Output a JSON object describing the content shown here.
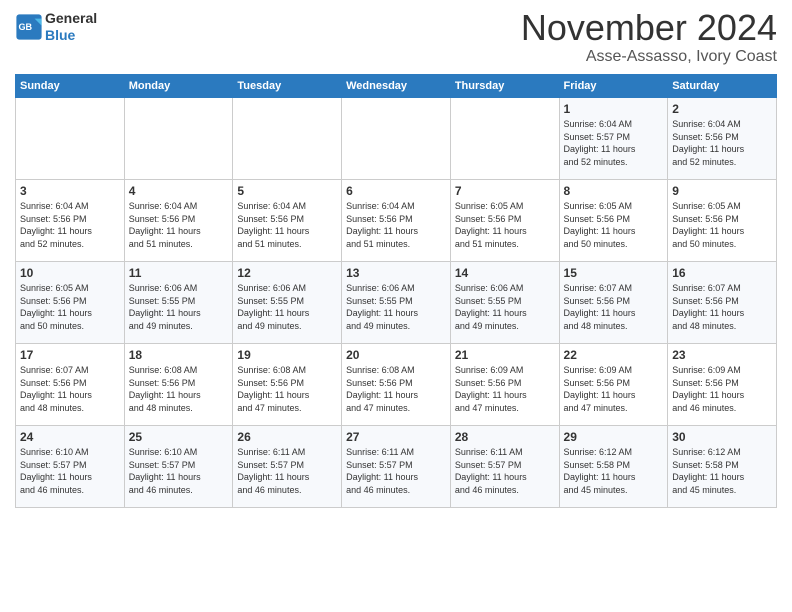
{
  "header": {
    "logo_line1": "General",
    "logo_line2": "Blue",
    "month_year": "November 2024",
    "location": "Asse-Assasso, Ivory Coast"
  },
  "days_of_week": [
    "Sunday",
    "Monday",
    "Tuesday",
    "Wednesday",
    "Thursday",
    "Friday",
    "Saturday"
  ],
  "weeks": [
    [
      {
        "day": "",
        "info": ""
      },
      {
        "day": "",
        "info": ""
      },
      {
        "day": "",
        "info": ""
      },
      {
        "day": "",
        "info": ""
      },
      {
        "day": "",
        "info": ""
      },
      {
        "day": "1",
        "info": "Sunrise: 6:04 AM\nSunset: 5:57 PM\nDaylight: 11 hours\nand 52 minutes."
      },
      {
        "day": "2",
        "info": "Sunrise: 6:04 AM\nSunset: 5:56 PM\nDaylight: 11 hours\nand 52 minutes."
      }
    ],
    [
      {
        "day": "3",
        "info": "Sunrise: 6:04 AM\nSunset: 5:56 PM\nDaylight: 11 hours\nand 52 minutes."
      },
      {
        "day": "4",
        "info": "Sunrise: 6:04 AM\nSunset: 5:56 PM\nDaylight: 11 hours\nand 51 minutes."
      },
      {
        "day": "5",
        "info": "Sunrise: 6:04 AM\nSunset: 5:56 PM\nDaylight: 11 hours\nand 51 minutes."
      },
      {
        "day": "6",
        "info": "Sunrise: 6:04 AM\nSunset: 5:56 PM\nDaylight: 11 hours\nand 51 minutes."
      },
      {
        "day": "7",
        "info": "Sunrise: 6:05 AM\nSunset: 5:56 PM\nDaylight: 11 hours\nand 51 minutes."
      },
      {
        "day": "8",
        "info": "Sunrise: 6:05 AM\nSunset: 5:56 PM\nDaylight: 11 hours\nand 50 minutes."
      },
      {
        "day": "9",
        "info": "Sunrise: 6:05 AM\nSunset: 5:56 PM\nDaylight: 11 hours\nand 50 minutes."
      }
    ],
    [
      {
        "day": "10",
        "info": "Sunrise: 6:05 AM\nSunset: 5:56 PM\nDaylight: 11 hours\nand 50 minutes."
      },
      {
        "day": "11",
        "info": "Sunrise: 6:06 AM\nSunset: 5:55 PM\nDaylight: 11 hours\nand 49 minutes."
      },
      {
        "day": "12",
        "info": "Sunrise: 6:06 AM\nSunset: 5:55 PM\nDaylight: 11 hours\nand 49 minutes."
      },
      {
        "day": "13",
        "info": "Sunrise: 6:06 AM\nSunset: 5:55 PM\nDaylight: 11 hours\nand 49 minutes."
      },
      {
        "day": "14",
        "info": "Sunrise: 6:06 AM\nSunset: 5:55 PM\nDaylight: 11 hours\nand 49 minutes."
      },
      {
        "day": "15",
        "info": "Sunrise: 6:07 AM\nSunset: 5:56 PM\nDaylight: 11 hours\nand 48 minutes."
      },
      {
        "day": "16",
        "info": "Sunrise: 6:07 AM\nSunset: 5:56 PM\nDaylight: 11 hours\nand 48 minutes."
      }
    ],
    [
      {
        "day": "17",
        "info": "Sunrise: 6:07 AM\nSunset: 5:56 PM\nDaylight: 11 hours\nand 48 minutes."
      },
      {
        "day": "18",
        "info": "Sunrise: 6:08 AM\nSunset: 5:56 PM\nDaylight: 11 hours\nand 48 minutes."
      },
      {
        "day": "19",
        "info": "Sunrise: 6:08 AM\nSunset: 5:56 PM\nDaylight: 11 hours\nand 47 minutes."
      },
      {
        "day": "20",
        "info": "Sunrise: 6:08 AM\nSunset: 5:56 PM\nDaylight: 11 hours\nand 47 minutes."
      },
      {
        "day": "21",
        "info": "Sunrise: 6:09 AM\nSunset: 5:56 PM\nDaylight: 11 hours\nand 47 minutes."
      },
      {
        "day": "22",
        "info": "Sunrise: 6:09 AM\nSunset: 5:56 PM\nDaylight: 11 hours\nand 47 minutes."
      },
      {
        "day": "23",
        "info": "Sunrise: 6:09 AM\nSunset: 5:56 PM\nDaylight: 11 hours\nand 46 minutes."
      }
    ],
    [
      {
        "day": "24",
        "info": "Sunrise: 6:10 AM\nSunset: 5:57 PM\nDaylight: 11 hours\nand 46 minutes."
      },
      {
        "day": "25",
        "info": "Sunrise: 6:10 AM\nSunset: 5:57 PM\nDaylight: 11 hours\nand 46 minutes."
      },
      {
        "day": "26",
        "info": "Sunrise: 6:11 AM\nSunset: 5:57 PM\nDaylight: 11 hours\nand 46 minutes."
      },
      {
        "day": "27",
        "info": "Sunrise: 6:11 AM\nSunset: 5:57 PM\nDaylight: 11 hours\nand 46 minutes."
      },
      {
        "day": "28",
        "info": "Sunrise: 6:11 AM\nSunset: 5:57 PM\nDaylight: 11 hours\nand 46 minutes."
      },
      {
        "day": "29",
        "info": "Sunrise: 6:12 AM\nSunset: 5:58 PM\nDaylight: 11 hours\nand 45 minutes."
      },
      {
        "day": "30",
        "info": "Sunrise: 6:12 AM\nSunset: 5:58 PM\nDaylight: 11 hours\nand 45 minutes."
      }
    ]
  ]
}
